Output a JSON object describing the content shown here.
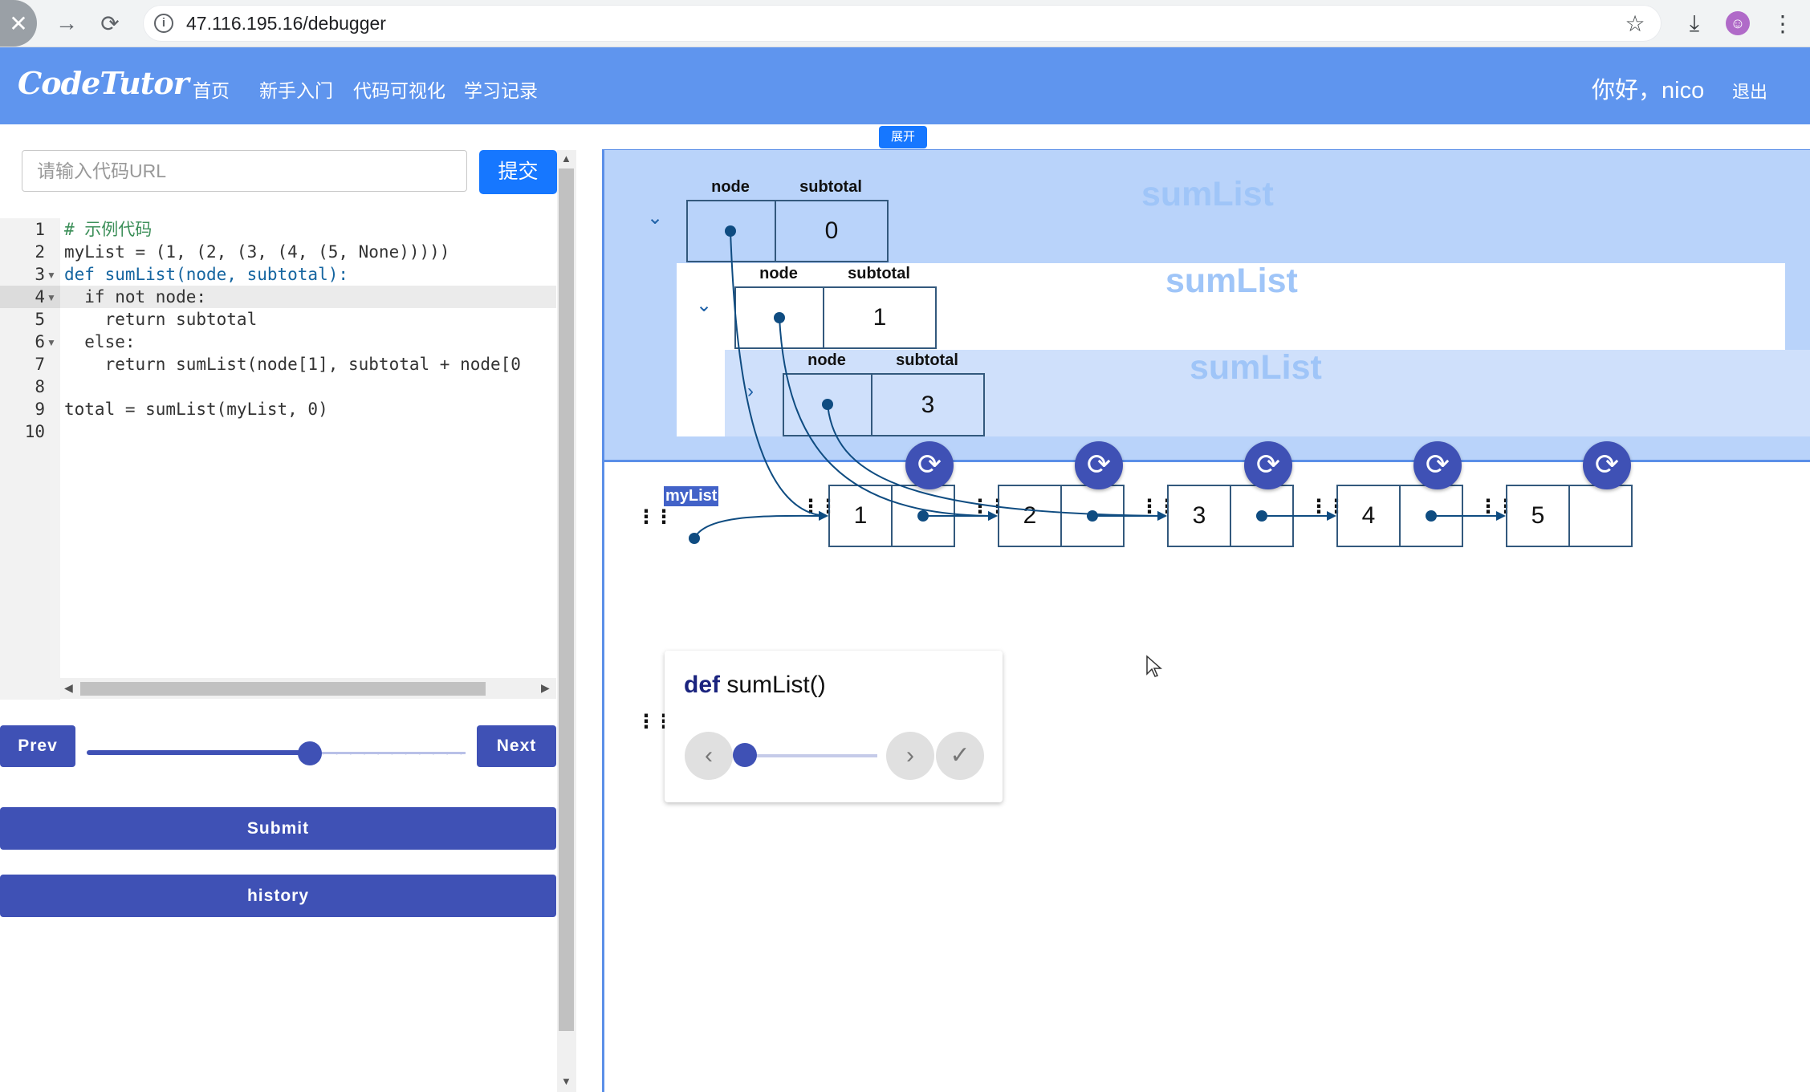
{
  "browser": {
    "url": "47.116.195.16/debugger",
    "back_icon": "arrow-back-icon",
    "forward_icon": "arrow-forward-icon",
    "reload_icon": "reload-icon"
  },
  "app": {
    "logo": "CodeTutor",
    "nav": [
      "首页",
      "新手入门",
      "代码可视化",
      "学习记录"
    ],
    "greeting": "你好，nico",
    "logout": "退出",
    "brand_color": "#5f95ee"
  },
  "left": {
    "url_placeholder": "请输入代码URL",
    "submit_url_label": "提交",
    "prev_label": "Prev",
    "next_label": "Next",
    "step_progress": 0.59,
    "submit_label": "Submit",
    "history_label": "history",
    "code_lines": [
      "# 示例代码",
      "myList = (1, (2, (3, (4, (5, None)))))",
      "def sumList(node, subtotal):",
      "  if not node:",
      "    return subtotal",
      "  else:",
      "    return sumList(node[1], subtotal + node[0",
      "",
      "total = sumList(myList, 0)",
      ""
    ],
    "line_numbers": [
      "1",
      "2",
      "3",
      "4",
      "5",
      "6",
      "7",
      "8",
      "9",
      "10"
    ],
    "active_line": 4
  },
  "right": {
    "expand_label": "展开",
    "frames": [
      {
        "name": "sumList",
        "node_label": "node",
        "subtotal_label": "subtotal",
        "subtotal": "0"
      },
      {
        "name": "sumList",
        "node_label": "node",
        "subtotal_label": "subtotal",
        "subtotal": "1"
      },
      {
        "name": "sumList",
        "node_label": "node",
        "subtotal_label": "subtotal",
        "subtotal": "3"
      }
    ],
    "variable_name": "myList",
    "list_values": [
      "1",
      "2",
      "3",
      "4",
      "5"
    ],
    "function_card": {
      "keyword": "def",
      "signature": "sumList()"
    }
  }
}
